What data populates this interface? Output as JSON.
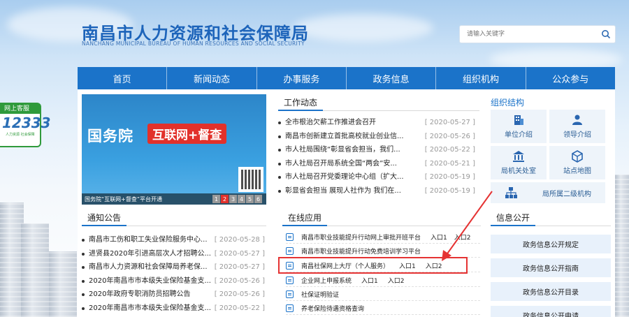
{
  "site": {
    "title": "南昌市人力资源和社会保障局",
    "subtitle": "NANCHANG MUNICIPAL BUREAU OF HUMAN RESOURCES AND SOCIAL SECURITY",
    "search_placeholder": "请输入关键字"
  },
  "nav": [
    "首页",
    "新闻动态",
    "办事服务",
    "政务信息",
    "组织机构",
    "公众参与"
  ],
  "side_widget": {
    "head": "网上客服",
    "number": "12333",
    "tiny": "人力资源 社会保障"
  },
  "banner": {
    "headline": "国务院",
    "tag": "互联网+督查",
    "caption": "国务院“互联网+督查”平台开通",
    "pages": [
      "1",
      "2",
      "3",
      "4",
      "5",
      "6"
    ],
    "active_page": "2"
  },
  "work_news": {
    "label": "工作动态",
    "items": [
      {
        "title": "全市根治欠薪工作推进会召开",
        "date": "[ 2020-05-27 ]"
      },
      {
        "title": "南昌市创新建立首批高校就业创业信...",
        "date": "[ 2020-05-26 ]"
      },
      {
        "title": "市人社局围绕“彰显省会担当，我们...",
        "date": "[ 2020-05-22 ]"
      },
      {
        "title": "市人社局召开局系统全国“两会”安...",
        "date": "[ 2020-05-21 ]"
      },
      {
        "title": "市人社局召开党委理论中心组（扩大...",
        "date": "[ 2020-05-19 ]"
      },
      {
        "title": "彰显省会担当 展现人社作为 我们在...",
        "date": "[ 2020-05-19 ]"
      }
    ]
  },
  "org": {
    "title": "组织结构",
    "tiles": [
      {
        "label": "单位介绍",
        "icon": "building-icon"
      },
      {
        "label": "领导介绍",
        "icon": "person-icon"
      },
      {
        "label": "局机关处室",
        "icon": "office-icon"
      },
      {
        "label": "站点地图",
        "icon": "cube-icon"
      },
      {
        "label": "局所属二级机构",
        "icon": "org-chart-icon"
      }
    ]
  },
  "notices": {
    "label": "通知公告",
    "items": [
      {
        "title": "南昌市工伤和职工失业保险服务中心...",
        "date": "[ 2020-05-28 ]"
      },
      {
        "title": "进贤县2020年引进高层次人才招聘公...",
        "date": "[ 2020-05-27 ]"
      },
      {
        "title": "南昌市人力资源和社会保障局养老保...",
        "date": "[ 2020-05-27 ]"
      },
      {
        "title": "2020年南昌市市本级失业保险基金支...",
        "date": "[ 2020-05-26 ]"
      },
      {
        "title": "2020年政府专职消防员招聘公告",
        "date": "[ 2020-05-26 ]"
      },
      {
        "title": "2020年南昌市市本级失业保险基金支...",
        "date": "[ 2020-05-22 ]"
      }
    ]
  },
  "online_apps": {
    "label": "在线应用",
    "items": [
      {
        "title": "南昌市职业技能提升行动网上审批开班平台",
        "entries": [
          "入口1",
          "入口2"
        ]
      },
      {
        "title": "南昌市职业技能提升行动免费培训学习平台",
        "entries": []
      },
      {
        "title": "南昌社保网上大厅（个人服务）",
        "entries": [
          "入口1",
          "入口2"
        ]
      },
      {
        "title": "企业网上申报系统",
        "entries": [
          "入口1",
          "入口2"
        ]
      },
      {
        "title": "社保证明验证",
        "entries": []
      },
      {
        "title": "养老保险待遇资格查询",
        "entries": []
      }
    ]
  },
  "info_public": {
    "label": "信息公开",
    "buttons": [
      "政务信息公开规定",
      "政务信息公开指南",
      "政务信息公开目录",
      "政务信息公开申请"
    ]
  },
  "colors": {
    "primary": "#1b73c9",
    "highlight": "#e53333",
    "accent_red": "#e2312b"
  }
}
